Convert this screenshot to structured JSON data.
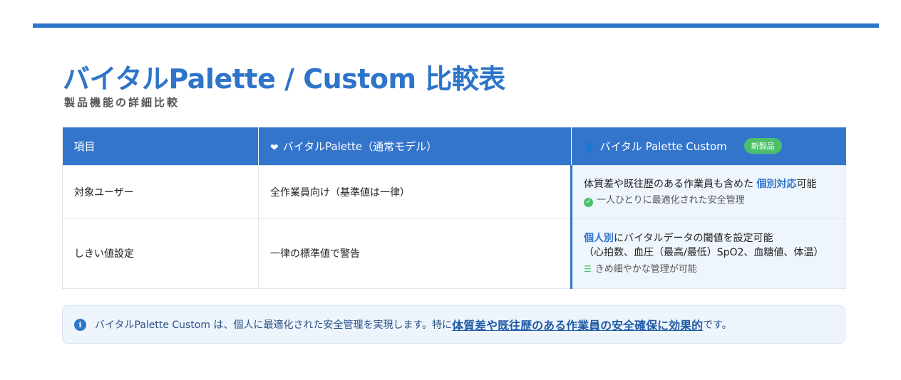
{
  "title": "バイタルPalette / Custom 比較表",
  "subtitle": "製品機能の詳細比較",
  "colors": {
    "accent": "#2e74c9",
    "header_bg": "#3475cc",
    "badge": "#4cbf6b",
    "custom_cell_bg": "#eef5fd"
  },
  "table": {
    "headers": {
      "item": "項目",
      "standard": "バイタルPalette（通常モデル）",
      "standard_icon": "heart-pulse-icon",
      "custom": "バイタル Palette Custom",
      "custom_icon": "user-settings-icon",
      "custom_badge": "新製品"
    },
    "rows": [
      {
        "item": "対象ユーザー",
        "standard": "全作業員向け（基準値は一律）",
        "custom_pre": "体質差や既往歴のある作業員も含めた ",
        "custom_hl": "個別対応",
        "custom_post": "可能",
        "custom_sub": "一人ひとりに最適化された安全管理",
        "custom_sub_icon": "check-circle-icon"
      },
      {
        "item": "しきい値設定",
        "standard": "一律の標準値で警告",
        "custom_hl": "個人別",
        "custom_post": "にバイタルデータの閾値を設定可能",
        "custom_line2": "（心拍数、血圧（最高/最低）SpO2、血糖値、体温）",
        "custom_sub": "きめ細やかな管理が可能",
        "custom_sub_icon": "sliders-icon"
      }
    ]
  },
  "note": {
    "icon": "info-icon",
    "text_pre": "バイタルPalette Custom は、個人に最適化された安全管理を実現します。特に",
    "text_em": "体質差や既往歴のある作業員の安全確保に効果的",
    "text_post": "です。"
  }
}
